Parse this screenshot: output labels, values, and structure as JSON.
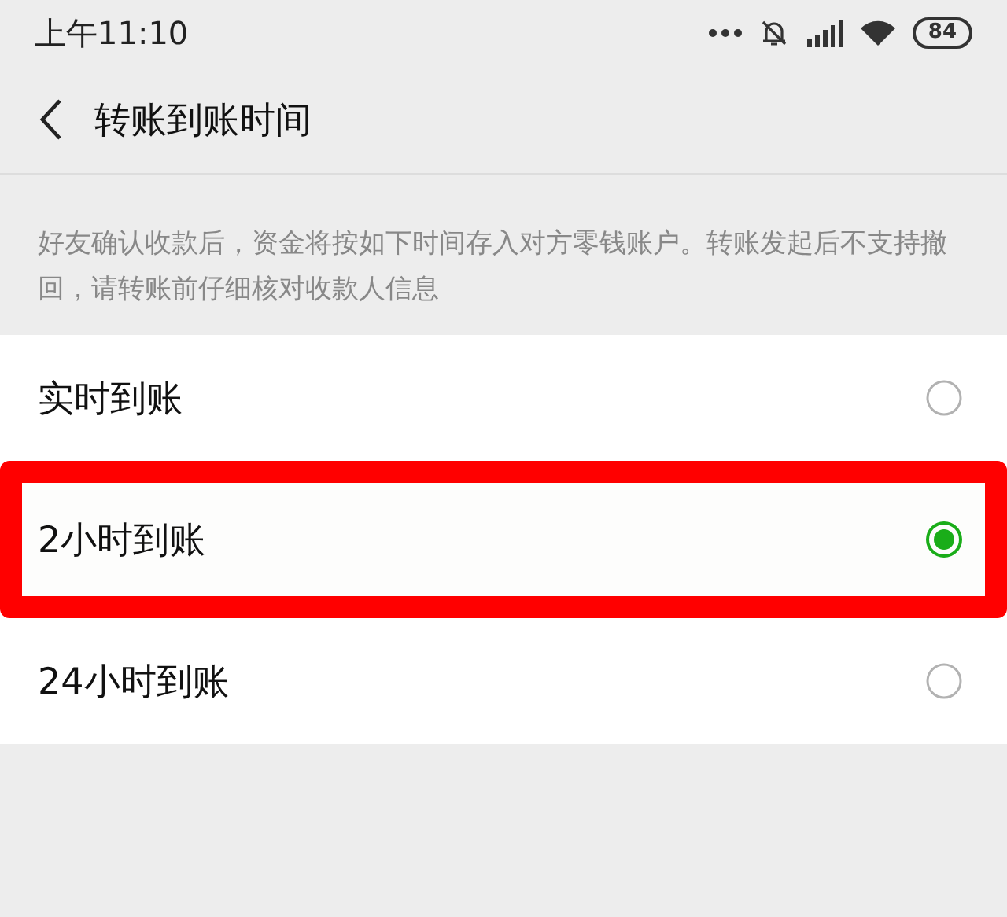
{
  "status_bar": {
    "time": "上午11:10",
    "battery": "84"
  },
  "nav": {
    "title": "转账到账时间"
  },
  "description": "好友确认收款后，资金将按如下时间存入对方零钱账户。转账发起后不支持撤回，请转账前仔细核对收款人信息",
  "options": [
    {
      "label": "实时到账",
      "selected": false,
      "highlighted": false
    },
    {
      "label": "2小时到账",
      "selected": true,
      "highlighted": true
    },
    {
      "label": "24小时到账",
      "selected": false,
      "highlighted": false
    }
  ]
}
